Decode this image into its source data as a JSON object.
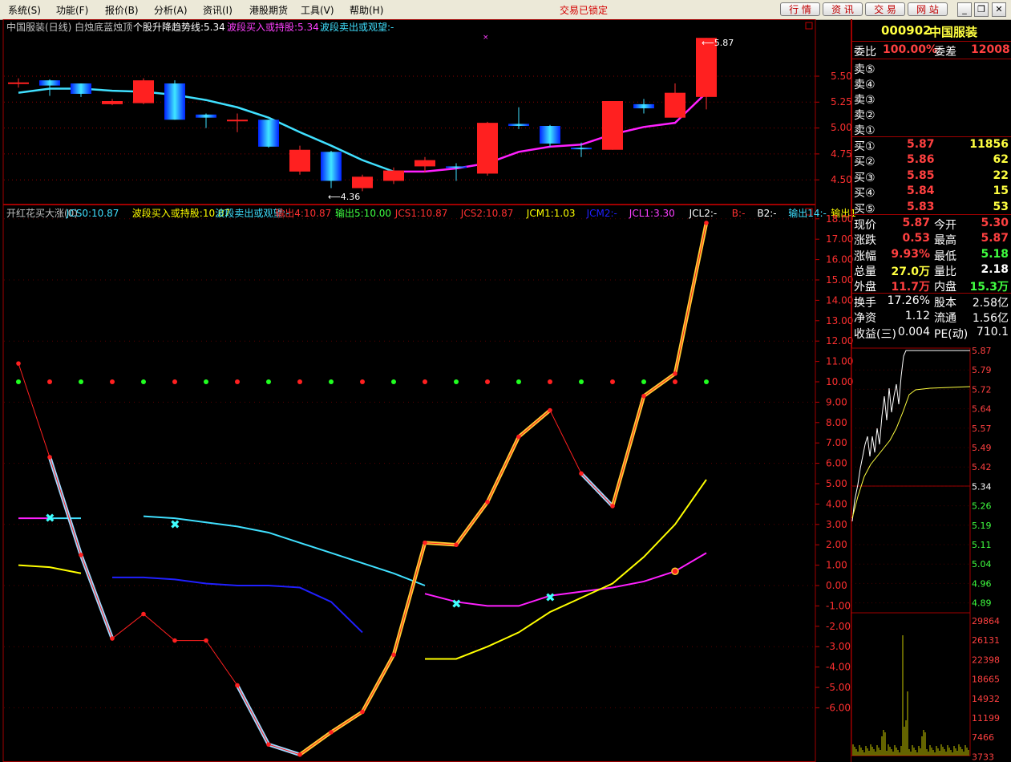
{
  "menubar": {
    "items": [
      "系统(S)",
      "功能(F)",
      "报价(B)",
      "分析(A)",
      "资讯(I)",
      "港股期货",
      "工具(V)",
      "帮助(H)"
    ],
    "lock_status": "交易已锁定",
    "buttons": [
      "行 情",
      "资 讯",
      "交 易",
      "网 站"
    ]
  },
  "upper": {
    "legend": [
      {
        "text": "中国服装(日线) 白烛底蓝烛顶",
        "color": "#c0c0c0"
      },
      {
        "text": "个股升降趋势线:5.34",
        "color": "#ffffff"
      },
      {
        "text": "波段买入或持股:5.34",
        "color": "#ff40ff"
      },
      {
        "text": "波段卖出或观望:-",
        "color": "#40e0ff"
      }
    ],
    "y_ticks": [
      "5.50",
      "5.25",
      "5.00",
      "4.75",
      "4.50"
    ],
    "high_marker": "5.87",
    "low_marker": "4.36"
  },
  "lower": {
    "legend": [
      {
        "text": "开红花买大涨(0)",
        "color": "#c0c0c0"
      },
      {
        "text": "JCS0:10.87",
        "color": "#40e0ff"
      },
      {
        "text": "波段买入或持股:10.87",
        "color": "#ffff00"
      },
      {
        "text": "波段卖出或观望:-",
        "color": "#40e0ff"
      },
      {
        "text": "输出4:10.87",
        "color": "#ff3030"
      },
      {
        "text": "输出5:10.00",
        "color": "#40ff40"
      },
      {
        "text": "JCS1:10.87",
        "color": "#ff3030"
      },
      {
        "text": "JCS2:10.87",
        "color": "#ff3030"
      },
      {
        "text": "JCM1:1.03",
        "color": "#ffff00"
      },
      {
        "text": "JCM2:-",
        "color": "#2020ff"
      },
      {
        "text": "JCL1:3.30",
        "color": "#ff40ff"
      },
      {
        "text": "JCL2:-",
        "color": "#ffffff"
      },
      {
        "text": "B:-",
        "color": "#ff3030"
      },
      {
        "text": "B2:-",
        "color": "#ffffff"
      },
      {
        "text": "输出14:-",
        "color": "#40e0ff"
      },
      {
        "text": "输出1",
        "color": "#ffff00"
      }
    ],
    "y_ticks": [
      "18.00",
      "17.00",
      "16.00",
      "15.00",
      "14.00",
      "13.00",
      "12.00",
      "11.00",
      "10.00",
      "9.00",
      "8.00",
      "7.00",
      "6.00",
      "5.00",
      "4.00",
      "3.00",
      "2.00",
      "1.00",
      "0.00",
      "-1.00",
      "-2.00",
      "-3.00",
      "-4.00",
      "-5.00",
      "-6.00"
    ]
  },
  "chart_data": {
    "type": "candlestick",
    "title": "中国服装(日线)",
    "candles": [
      {
        "o": 5.44,
        "h": 5.48,
        "l": 5.39,
        "c": 5.43,
        "fill": "#ff2020"
      },
      {
        "o": 5.41,
        "h": 5.47,
        "l": 5.31,
        "c": 5.46,
        "fill": "blue"
      },
      {
        "o": 5.33,
        "h": 5.43,
        "l": 5.3,
        "c": 5.43,
        "fill": "blue"
      },
      {
        "o": 5.26,
        "h": 5.28,
        "l": 5.22,
        "c": 5.23,
        "fill": "#ff2020"
      },
      {
        "o": 5.24,
        "h": 5.48,
        "l": 5.23,
        "c": 5.46,
        "fill": "#ff2020"
      },
      {
        "o": 5.43,
        "h": 5.46,
        "l": 5.08,
        "c": 5.08,
        "fill": "blue"
      },
      {
        "o": 5.1,
        "h": 5.14,
        "l": 5.0,
        "c": 5.13,
        "fill": "blue"
      },
      {
        "o": 5.08,
        "h": 5.14,
        "l": 4.96,
        "c": 5.08,
        "fill": "#ff2020"
      },
      {
        "o": 4.82,
        "h": 5.08,
        "l": 4.81,
        "c": 5.08,
        "fill": "blue"
      },
      {
        "o": 4.79,
        "h": 4.83,
        "l": 4.55,
        "c": 4.58,
        "fill": "#ff2020"
      },
      {
        "o": 4.49,
        "h": 4.78,
        "l": 4.42,
        "c": 4.77,
        "fill": "blue"
      },
      {
        "o": 4.53,
        "h": 4.55,
        "l": 4.39,
        "c": 4.42,
        "fill": "#ff2020"
      },
      {
        "o": 4.59,
        "h": 4.62,
        "l": 4.46,
        "c": 4.49,
        "fill": "#ff2020"
      },
      {
        "o": 4.69,
        "h": 4.72,
        "l": 4.57,
        "c": 4.63,
        "fill": "#ff2020"
      },
      {
        "o": 4.63,
        "h": 4.66,
        "l": 4.49,
        "c": 4.63,
        "fill": "blue"
      },
      {
        "o": 4.56,
        "h": 5.06,
        "l": 4.54,
        "c": 5.05,
        "fill": "#ff2020"
      },
      {
        "o": 5.02,
        "h": 5.2,
        "l": 4.99,
        "c": 5.04,
        "fill": "blue"
      },
      {
        "o": 4.85,
        "h": 5.03,
        "l": 4.82,
        "c": 5.02,
        "fill": "blue"
      },
      {
        "o": 4.8,
        "h": 4.86,
        "l": 4.72,
        "c": 4.81,
        "fill": "blue"
      },
      {
        "o": 4.79,
        "h": 5.26,
        "l": 4.79,
        "c": 5.26,
        "fill": "#ff2020"
      },
      {
        "o": 5.19,
        "h": 5.28,
        "l": 5.14,
        "c": 5.23,
        "fill": "blue"
      },
      {
        "o": 5.1,
        "h": 5.43,
        "l": 5.1,
        "c": 5.34,
        "fill": "#ff2020"
      },
      {
        "o": 5.3,
        "h": 5.87,
        "l": 5.18,
        "c": 5.87,
        "fill": "#ff2020"
      }
    ],
    "upper_trend": {
      "name": "个股升降趋势线",
      "values": [
        5.34,
        5.38,
        5.38,
        5.36,
        5.35,
        5.32,
        5.27,
        5.2,
        5.1,
        4.96,
        4.83,
        4.69,
        4.58,
        4.58,
        4.61,
        4.66,
        4.77,
        4.82,
        4.84,
        4.94,
        5.01,
        5.05,
        5.34
      ]
    },
    "lower": {
      "red_line": [
        10.9,
        6.3,
        1.5,
        -2.6,
        -1.4,
        -2.7,
        -2.7,
        -4.9,
        -7.8,
        -8.3,
        -7.2,
        -6.2,
        -3.4,
        2.1,
        2.0,
        4.1,
        7.3,
        8.6,
        5.5,
        3.9,
        9.3,
        10.4,
        17.8
      ],
      "dots": [
        10,
        10,
        10,
        10,
        10,
        10,
        10,
        10,
        10,
        10,
        10,
        10,
        10,
        10,
        10,
        10,
        10,
        10,
        10,
        10,
        10,
        10,
        10
      ],
      "cyan_line": [
        3.3,
        3.3,
        null,
        3.4,
        3.3,
        3.1,
        2.9,
        2.6,
        2.1,
        1.6,
        1.1,
        0.6,
        0.0
      ],
      "blue_line": [
        0.4,
        0.4,
        0.3,
        0.1,
        0.0,
        0.0,
        -0.1,
        -0.8,
        -2.3
      ],
      "magenta_left": [
        3.3,
        3.3
      ],
      "yellow_left": [
        1.0,
        0.9,
        0.6
      ],
      "magenta_right": [
        -0.4,
        -0.8,
        -1.0,
        -1.0,
        -0.5,
        -0.3,
        -0.1,
        0.2,
        0.7,
        1.6
      ],
      "yellow_right": [
        -3.6,
        -3.6,
        -3.0,
        -2.3,
        -1.3,
        -0.6,
        0.1,
        1.4,
        3.0,
        5.2
      ]
    }
  },
  "right_panel": {
    "code": "000902",
    "name": "中国服装",
    "weibi_label": "委比",
    "weibi_value": "100.00%",
    "weicha_label": "委差",
    "weicha_value": "12008",
    "sell": [
      "卖⑤",
      "卖④",
      "卖③",
      "卖②",
      "卖①"
    ],
    "buy": [
      {
        "label": "买①",
        "price": "5.87",
        "vol": "11856"
      },
      {
        "label": "买②",
        "price": "5.86",
        "vol": "62"
      },
      {
        "label": "买③",
        "price": "5.85",
        "vol": "22"
      },
      {
        "label": "买④",
        "price": "5.84",
        "vol": "15"
      },
      {
        "label": "买⑤",
        "price": "5.83",
        "vol": "53"
      }
    ],
    "stats": [
      {
        "l1": "现价",
        "v1": "5.87",
        "c1": "#ff4040",
        "l2": "今开",
        "v2": "5.30",
        "c2": "#ff4040"
      },
      {
        "l1": "涨跌",
        "v1": "0.53",
        "c1": "#ff4040",
        "l2": "最高",
        "v2": "5.87",
        "c2": "#ff4040"
      },
      {
        "l1": "涨幅",
        "v1": "9.93%",
        "c1": "#ff4040",
        "l2": "最低",
        "v2": "5.18",
        "c2": "#40ff40"
      },
      {
        "l1": "总量",
        "v1": "27.0万",
        "c1": "#ffff40",
        "l2": "量比",
        "v2": "2.18",
        "c2": "#ffffff"
      },
      {
        "l1": "外盘",
        "v1": "11.7万",
        "c1": "#ff4040",
        "l2": "内盘",
        "v2": "15.3万",
        "c2": "#40ff40"
      }
    ],
    "stats2": [
      {
        "l1": "换手",
        "v1": "17.26%",
        "l2": "股本",
        "v2": "2.58亿"
      },
      {
        "l1": "净资",
        "v1": "1.12",
        "l2": "流通",
        "v2": "1.56亿"
      },
      {
        "l1": "收益(三)",
        "v1": "0.004",
        "l2": "PE(动)",
        "v2": "710.1"
      }
    ],
    "mini_price_ticks": [
      {
        "v": "5.87",
        "c": "#ff4040"
      },
      {
        "v": "5.79",
        "c": "#ff4040"
      },
      {
        "v": "5.72",
        "c": "#ff4040"
      },
      {
        "v": "5.64",
        "c": "#ff4040"
      },
      {
        "v": "5.57",
        "c": "#ff4040"
      },
      {
        "v": "5.49",
        "c": "#ff4040"
      },
      {
        "v": "5.42",
        "c": "#ff4040"
      },
      {
        "v": "5.34",
        "c": "#ffffff"
      },
      {
        "v": "5.26",
        "c": "#40ff40"
      },
      {
        "v": "5.19",
        "c": "#40ff40"
      },
      {
        "v": "5.11",
        "c": "#40ff40"
      },
      {
        "v": "5.04",
        "c": "#40ff40"
      },
      {
        "v": "4.96",
        "c": "#40ff40"
      },
      {
        "v": "4.89",
        "c": "#40ff40"
      }
    ],
    "mini_vol_ticks": [
      "29864",
      "26131",
      "22398",
      "18665",
      "14932",
      "11199",
      "7466",
      "3733"
    ]
  }
}
